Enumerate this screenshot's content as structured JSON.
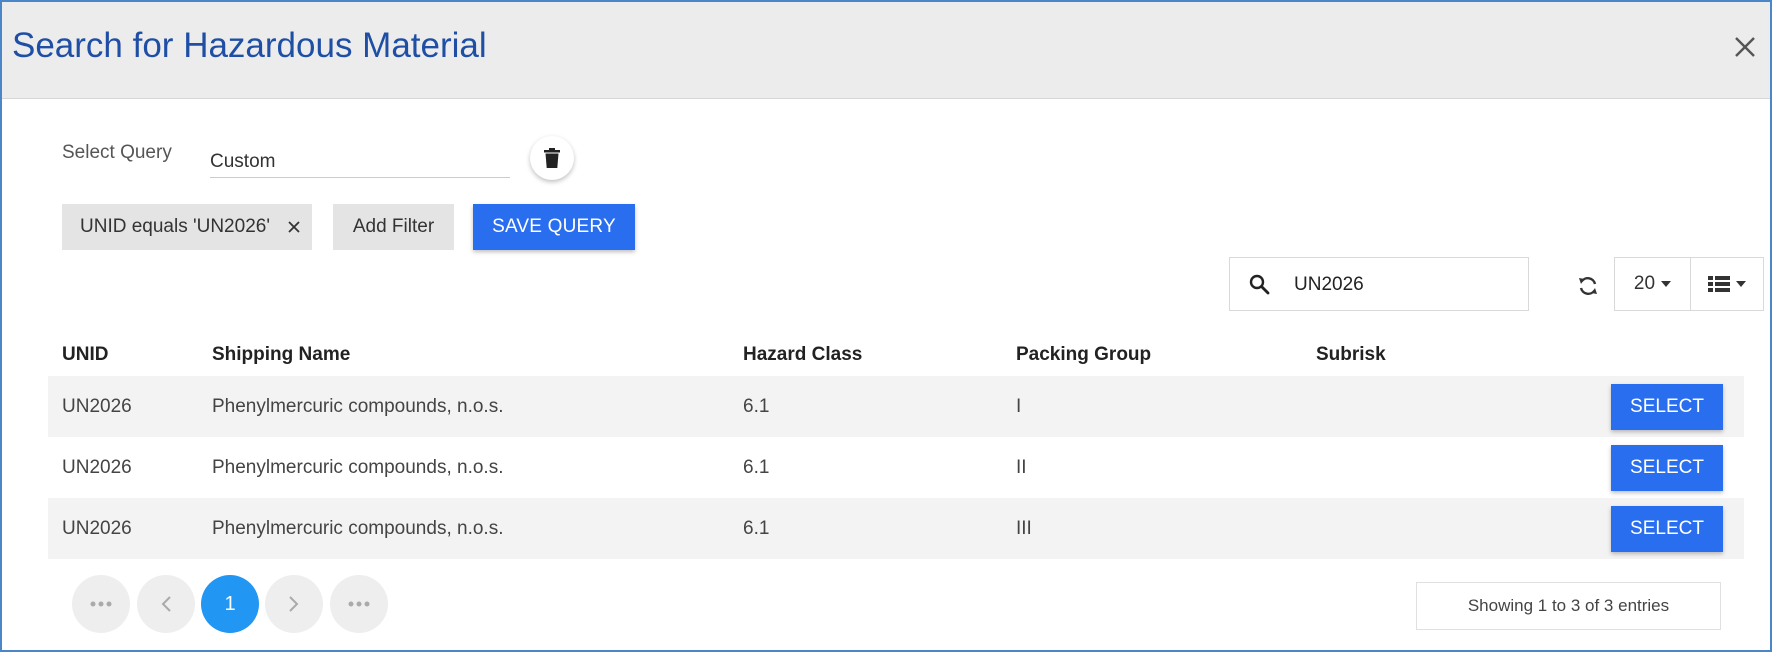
{
  "dialog": {
    "title": "Search for Hazardous Material"
  },
  "query": {
    "label": "Select Query",
    "value": "Custom"
  },
  "filters": {
    "chip_label": "UNID equals 'UN2026'",
    "add_filter_label": "Add Filter",
    "save_query_label": "SAVE QUERY"
  },
  "toolbar": {
    "search_value": "UN2026",
    "page_size": "20"
  },
  "table": {
    "headers": [
      "UNID",
      "Shipping Name",
      "Hazard Class",
      "Packing Group",
      "Subrisk"
    ],
    "rows": [
      {
        "unid": "UN2026",
        "shipping_name": "Phenylmercuric compounds, n.o.s.",
        "hazard_class": "6.1",
        "packing_group": "I",
        "subrisk": "",
        "action": "SELECT"
      },
      {
        "unid": "UN2026",
        "shipping_name": "Phenylmercuric compounds, n.o.s.",
        "hazard_class": "6.1",
        "packing_group": "II",
        "subrisk": "",
        "action": "SELECT"
      },
      {
        "unid": "UN2026",
        "shipping_name": "Phenylmercuric compounds, n.o.s.",
        "hazard_class": "6.1",
        "packing_group": "III",
        "subrisk": "",
        "action": "SELECT"
      }
    ]
  },
  "pagination": {
    "current_page": "1",
    "summary": "Showing 1 to 3 of 3 entries"
  },
  "icons": {
    "close": "close-icon",
    "trash": "trash-icon",
    "search": "search-icon",
    "refresh": "refresh-icon",
    "list_view": "list-view-icon"
  },
  "colors": {
    "title": "#1f4fa5",
    "primary_button": "#2a6ef0",
    "active_page": "#2196f3",
    "header_bg": "#ececec",
    "dialog_border": "#4a86c8"
  }
}
